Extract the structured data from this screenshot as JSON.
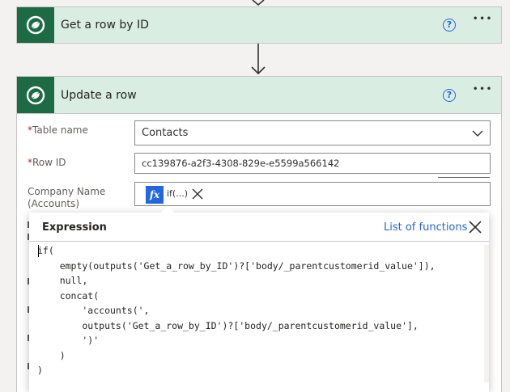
{
  "card1": {
    "title": "Get a row by ID",
    "help": "?",
    "more": "•••"
  },
  "card2": {
    "title": "Update a row",
    "help": "?",
    "more": "•••"
  },
  "fields": {
    "table_name": {
      "required": "*",
      "label": "Table name",
      "value": "Contacts"
    },
    "row_id": {
      "required": "*",
      "label": "Row ID",
      "value": "cc139876-a2f3-4308-829e-e5599a566142"
    },
    "company": {
      "label_line1": "Company Name",
      "label_line2": "(Accounts)",
      "token_icon": "fx",
      "token_text": "if(...)"
    }
  },
  "expression": {
    "title": "Expression",
    "list_link": "List of functions",
    "code": "if(\n    empty(outputs('Get_a_row_by_ID')?['body/_parentcustomerid_value']),\n    null,\n    concat(\n        'accounts(',\n        outputs('Get_a_row_by_ID')?['body/_parentcustomerid_value'],\n        ')'\n    )\n)"
  },
  "colors": {
    "accent": "#2266e3",
    "header_bg": "#d9ede2",
    "logo_bg": "#1d6b45"
  }
}
